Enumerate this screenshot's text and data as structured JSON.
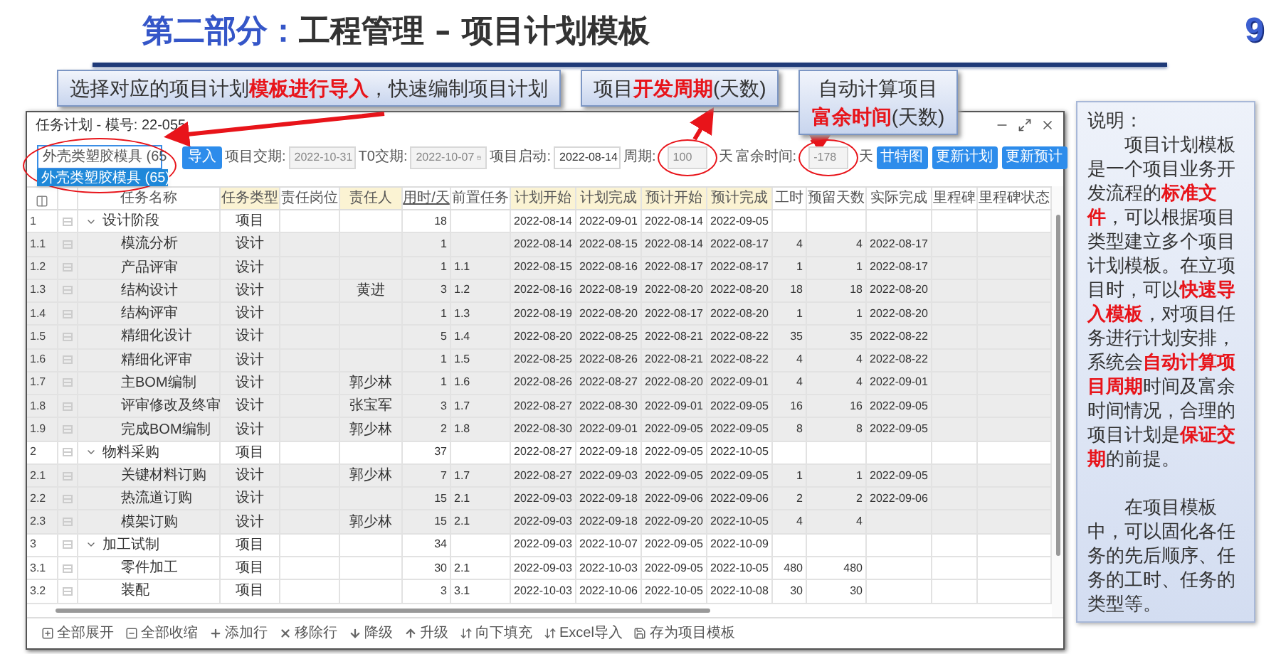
{
  "slide": {
    "section": "第二部分：",
    "title": "工程管理 – 项目计划模板",
    "page_number": "9"
  },
  "callouts": [
    {
      "lines": [
        "选择对应的项目计划**模板进行导入**，快速编制项目计划"
      ]
    },
    {
      "lines": [
        "项目**开发周期**(天数)"
      ]
    },
    {
      "lines": [
        "自动计算项目",
        "**富余时间**(天数)"
      ]
    }
  ],
  "window": {
    "title": "任务计划 - 模号: 22-055"
  },
  "toolbar": {
    "template_select": {
      "value": "外壳类塑胶模具 (65",
      "circled": true,
      "options": [
        {
          "label": "外壳类塑胶模具 (65)",
          "selected": true
        }
      ]
    },
    "import_button": "导入",
    "fields": [
      {
        "label": "项目交期:",
        "value": "2022-10-31",
        "disabled": true,
        "kind": "text",
        "circled": false
      },
      {
        "label": "T0交期:",
        "value": "2022-10-07",
        "disabled": true,
        "kind": "date",
        "circled": false
      },
      {
        "label": "项目启动:",
        "value": "2022-08-14",
        "disabled": false,
        "kind": "text",
        "circled": false
      },
      {
        "label": "周期:",
        "value": "100",
        "disabled": true,
        "kind": "text",
        "unit": "天",
        "circled": true
      },
      {
        "label": "富余时间:",
        "value": "-178",
        "disabled": true,
        "kind": "text",
        "unit": "天",
        "circled": true
      }
    ],
    "buttons": [
      "甘特图",
      "更新计划",
      "更新预计"
    ]
  },
  "table": {
    "columns": [
      {
        "label": "任务名称",
        "highlighted": false,
        "underlined": false
      },
      {
        "label": "任务类型",
        "highlighted": true,
        "underlined": false
      },
      {
        "label": "责任岗位",
        "highlighted": false,
        "underlined": false
      },
      {
        "label": "责任人",
        "highlighted": true,
        "underlined": false
      },
      {
        "label": "用时/天",
        "highlighted": false,
        "underlined": true
      },
      {
        "label": "前置任务",
        "highlighted": false,
        "underlined": false
      },
      {
        "label": "计划开始",
        "highlighted": true,
        "underlined": false
      },
      {
        "label": "计划完成",
        "highlighted": true,
        "underlined": false
      },
      {
        "label": "预计开始",
        "highlighted": true,
        "underlined": false
      },
      {
        "label": "预计完成",
        "highlighted": true,
        "underlined": false
      },
      {
        "label": "工时",
        "highlighted": false,
        "underlined": false
      },
      {
        "label": "预留天数",
        "highlighted": false,
        "underlined": false
      },
      {
        "label": "实际完成",
        "highlighted": false,
        "underlined": false
      },
      {
        "label": "里程碑",
        "highlighted": false,
        "underlined": false
      },
      {
        "label": "里程碑状态",
        "highlighted": false,
        "underlined": false
      }
    ],
    "rows": [
      {
        "no": "1",
        "name": "设计阶段",
        "type": "项目",
        "days": "18",
        "plan_start": "2022-08-14",
        "plan_end": "2022-09-01",
        "est_start": "2022-08-14",
        "est_end": "2022-09-05",
        "expanded": true,
        "children": [
          {
            "no": "1.1",
            "name": "模流分析",
            "type": "设计",
            "days": "1",
            "plan_start": "2022-08-14",
            "plan_end": "2022-08-15",
            "est_start": "2022-08-14",
            "est_end": "2022-08-17",
            "hours": "4",
            "reserve": "4",
            "actual_end": "2022-08-17",
            "highlighted": true
          },
          {
            "no": "1.2",
            "name": "产品评审",
            "type": "设计",
            "days": "1",
            "predecessor": "1.1",
            "plan_start": "2022-08-15",
            "plan_end": "2022-08-16",
            "est_start": "2022-08-17",
            "est_end": "2022-08-17",
            "hours": "1",
            "reserve": "1",
            "actual_end": "2022-08-17",
            "highlighted": true
          },
          {
            "no": "1.3",
            "name": "结构设计",
            "type": "设计",
            "owner": "黄进",
            "days": "3",
            "predecessor": "1.2",
            "plan_start": "2022-08-16",
            "plan_end": "2022-08-19",
            "est_start": "2022-08-20",
            "est_end": "2022-08-20",
            "hours": "18",
            "reserve": "18",
            "actual_end": "2022-08-20",
            "highlighted": true
          },
          {
            "no": "1.4",
            "name": "结构评审",
            "type": "设计",
            "days": "1",
            "predecessor": "1.3",
            "plan_start": "2022-08-19",
            "plan_end": "2022-08-20",
            "est_start": "2022-08-17",
            "est_end": "2022-08-20",
            "hours": "1",
            "reserve": "1",
            "actual_end": "2022-08-20",
            "highlighted": true
          },
          {
            "no": "1.5",
            "name": "精细化设计",
            "type": "设计",
            "days": "5",
            "predecessor": "1.4",
            "plan_start": "2022-08-20",
            "plan_end": "2022-08-25",
            "est_start": "2022-08-21",
            "est_end": "2022-08-22",
            "hours": "35",
            "reserve": "35",
            "actual_end": "2022-08-22",
            "highlighted": true
          },
          {
            "no": "1.6",
            "name": "精细化评审",
            "type": "设计",
            "days": "1",
            "predecessor": "1.5",
            "plan_start": "2022-08-25",
            "plan_end": "2022-08-26",
            "est_start": "2022-08-21",
            "est_end": "2022-08-22",
            "hours": "4",
            "reserve": "4",
            "actual_end": "2022-08-22",
            "highlighted": true
          },
          {
            "no": "1.7",
            "name": "主BOM编制",
            "type": "设计",
            "owner": "郭少林",
            "days": "1",
            "predecessor": "1.6",
            "plan_start": "2022-08-26",
            "plan_end": "2022-08-27",
            "est_start": "2022-08-20",
            "est_end": "2022-09-01",
            "hours": "4",
            "reserve": "4",
            "actual_end": "2022-09-01",
            "highlighted": true
          },
          {
            "no": "1.8",
            "name": "评审修改及终审",
            "type": "设计",
            "owner": "张宝军",
            "days": "3",
            "predecessor": "1.7",
            "plan_start": "2022-08-27",
            "plan_end": "2022-08-30",
            "est_start": "2022-09-01",
            "est_end": "2022-09-05",
            "hours": "16",
            "reserve": "16",
            "actual_end": "2022-09-05",
            "highlighted": true
          },
          {
            "no": "1.9",
            "name": "完成BOM编制",
            "type": "设计",
            "owner": "郭少林",
            "days": "2",
            "predecessor": "1.8",
            "plan_start": "2022-08-30",
            "plan_end": "2022-09-01",
            "est_start": "2022-09-05",
            "est_end": "2022-09-05",
            "hours": "8",
            "reserve": "8",
            "actual_end": "2022-09-05",
            "highlighted": true
          }
        ]
      },
      {
        "no": "2",
        "name": "物料采购",
        "type": "项目",
        "days": "37",
        "plan_start": "2022-08-27",
        "plan_end": "2022-09-18",
        "est_start": "2022-09-05",
        "est_end": "2022-10-05",
        "expanded": true,
        "children": [
          {
            "no": "2.1",
            "name": "关键材料订购",
            "type": "设计",
            "owner": "郭少林",
            "days": "7",
            "predecessor": "1.7",
            "plan_start": "2022-08-27",
            "plan_end": "2022-09-03",
            "est_start": "2022-09-05",
            "est_end": "2022-09-05",
            "hours": "1",
            "reserve": "1",
            "actual_end": "2022-09-05",
            "highlighted": true
          },
          {
            "no": "2.2",
            "name": "热流道订购",
            "type": "设计",
            "days": "15",
            "predecessor": "2.1",
            "plan_start": "2022-09-03",
            "plan_end": "2022-09-18",
            "est_start": "2022-09-06",
            "est_end": "2022-09-06",
            "hours": "2",
            "reserve": "2",
            "actual_end": "2022-09-06",
            "highlighted": true
          },
          {
            "no": "2.3",
            "name": "模架订购",
            "type": "设计",
            "owner": "郭少林",
            "days": "15",
            "predecessor": "2.1",
            "plan_start": "2022-09-03",
            "plan_end": "2022-09-18",
            "est_start": "2022-09-20",
            "est_end": "2022-10-05",
            "hours": "4",
            "reserve": "4",
            "highlighted": true
          }
        ]
      },
      {
        "no": "3",
        "name": "加工试制",
        "type": "项目",
        "days": "34",
        "plan_start": "2022-09-03",
        "plan_end": "2022-10-07",
        "est_start": "2022-09-05",
        "est_end": "2022-10-09",
        "expanded": true,
        "children": [
          {
            "no": "3.1",
            "name": "零件加工",
            "type": "项目",
            "days": "30",
            "predecessor": "2.1",
            "plan_start": "2022-09-03",
            "plan_end": "2022-10-03",
            "est_start": "2022-09-05",
            "est_end": "2022-10-05",
            "hours": "480",
            "reserve": "480",
            "highlighted": false
          },
          {
            "no": "3.2",
            "name": "装配",
            "type": "项目",
            "days": "3",
            "predecessor": "3.1",
            "plan_start": "2022-10-03",
            "plan_end": "2022-10-06",
            "est_start": "2022-10-05",
            "est_end": "2022-10-08",
            "hours": "30",
            "reserve": "30",
            "highlighted": false
          }
        ]
      }
    ]
  },
  "bottom_toolbar": [
    {
      "label": "全部展开",
      "kind": "expand"
    },
    {
      "label": "全部收缩",
      "kind": "collapse"
    },
    {
      "label": "添加行",
      "kind": "add"
    },
    {
      "label": "移除行",
      "kind": "remove"
    },
    {
      "label": "降级",
      "kind": "demote"
    },
    {
      "label": "升级",
      "kind": "promote"
    },
    {
      "label": "向下填充",
      "kind": "fill"
    },
    {
      "label": "Excel导入",
      "kind": "import"
    },
    {
      "label": "存为项目模板",
      "kind": "save"
    }
  ],
  "side_panel": {
    "heading": "说明：",
    "paragraphs": [
      "项目计划模板是一个项目业务开发流程的**标准文件**，可以根据项目类型建立多个项目计划模板。在立项目时，可以**快速导入模板**，对项目任务进行计划安排，系统会**自动计算项目周期**时间及富余时间情况，合理的项目计划是**保证交期**的前提。",
      "在项目模板中，可以固化各任务的先后顺序、任务的工时、任务的类型等。"
    ]
  }
}
